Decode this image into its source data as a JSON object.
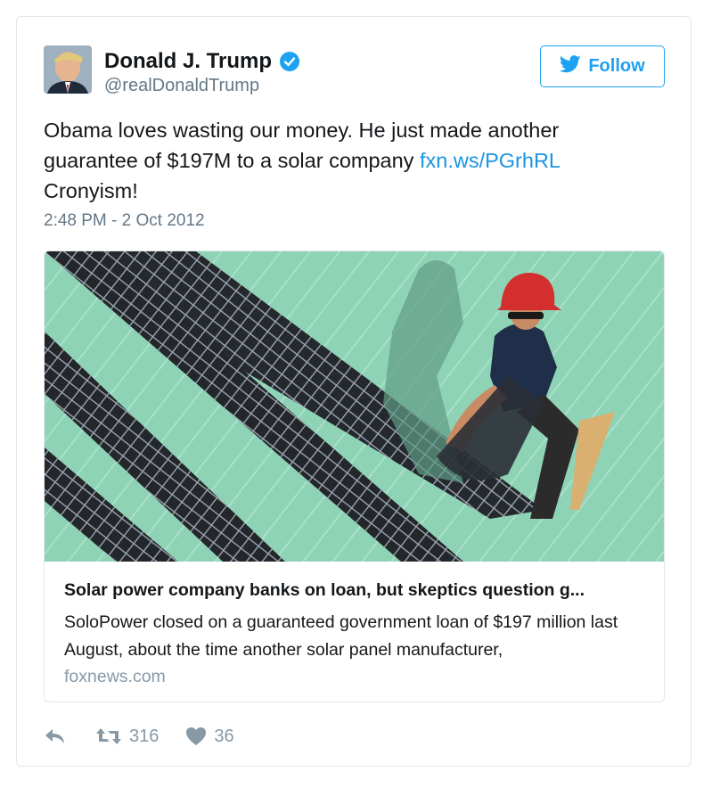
{
  "user": {
    "name": "Donald J. Trump",
    "handle": "@realDonaldTrump",
    "verified": true
  },
  "follow_label": "Follow",
  "tweet": {
    "text_before": "Obama loves wasting our money. He just made another guarantee of $197M to a solar company ",
    "link": "fxn.ws/PGrhRL",
    "text_after": "Cronyism!",
    "timestamp": "2:48 PM - 2 Oct 2012"
  },
  "card": {
    "title": "Solar power company banks on loan, but skeptics question g...",
    "description": "SoloPower closed on a guaranteed government loan of $197 million last August, about the time another solar panel manufacturer,",
    "domain": "foxnews.com"
  },
  "actions": {
    "retweets": "316",
    "likes": "36"
  },
  "colors": {
    "accent": "#1da1f2",
    "link": "#1b95e0",
    "muted": "#657786",
    "roof": "#8fd3b6"
  },
  "icons": [
    "verified-badge-icon",
    "twitter-bird-icon",
    "reply-icon",
    "retweet-icon",
    "heart-icon"
  ]
}
